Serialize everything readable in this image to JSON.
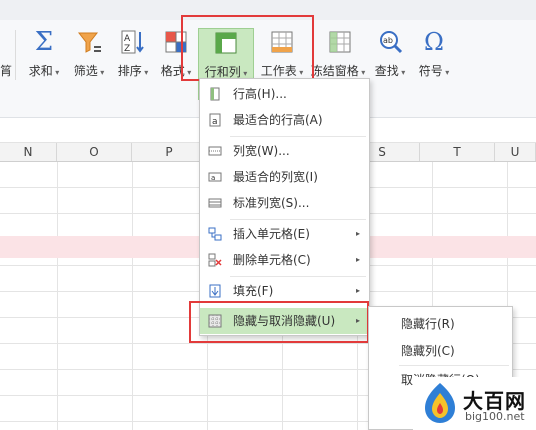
{
  "ribbon": {
    "left_partial": "筲",
    "buttons": [
      {
        "label": "求和",
        "icon": "sigma-icon"
      },
      {
        "label": "筛选",
        "icon": "funnel-icon"
      },
      {
        "label": "排序",
        "icon": "sort-az-icon"
      },
      {
        "label": "格式",
        "icon": "format-icon"
      },
      {
        "label": "行和列",
        "icon": "rows-columns-icon"
      },
      {
        "label": "工作表",
        "icon": "worksheet-icon"
      },
      {
        "label": "冻结窗格",
        "icon": "freeze-panes-icon"
      },
      {
        "label": "查找",
        "icon": "find-icon"
      },
      {
        "label": "符号",
        "icon": "omega-icon"
      }
    ],
    "accent": "#c9e8c0",
    "highlight_box_color": "#e23a3a"
  },
  "columns": [
    "N",
    "O",
    "P",
    "S",
    "T",
    "U"
  ],
  "menu": {
    "items": [
      {
        "label": "行高(H)...",
        "icon": "row-height-icon"
      },
      {
        "label": "最适合的行高(A)",
        "icon": "autofit-row-icon"
      },
      {
        "label": "列宽(W)...",
        "icon": "column-width-icon"
      },
      {
        "label": "最适合的列宽(I)",
        "icon": "autofit-column-icon"
      },
      {
        "label": "标准列宽(S)...",
        "icon": "standard-width-icon"
      },
      {
        "label": "插入单元格(E)",
        "icon": "insert-cells-icon",
        "submenu": true
      },
      {
        "label": "删除单元格(C)",
        "icon": "delete-cells-icon",
        "submenu": true
      },
      {
        "label": "填充(F)",
        "icon": "fill-down-icon",
        "submenu": true
      },
      {
        "label": "隐藏与取消隐藏(U)",
        "icon": "hide-unhide-icon",
        "submenu": true
      }
    ],
    "arrow": "▸"
  },
  "submenu": {
    "items": [
      "隐藏行(R)",
      "隐藏列(C)",
      "取消隐藏行(O)"
    ]
  },
  "watermark": {
    "brand": "大百网",
    "url": "big100.net"
  },
  "selected_row_color": "#fbe3e6"
}
